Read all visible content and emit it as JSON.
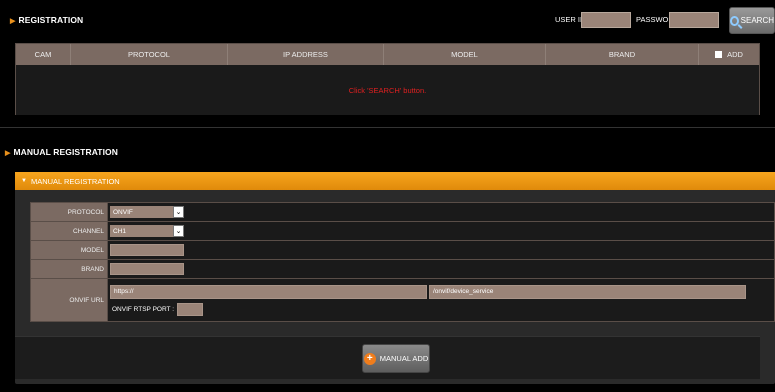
{
  "registration": {
    "title": "REGISTRATION",
    "user_id_label": "USER ID :",
    "user_id_value": "",
    "password_label": "PASSWORD :",
    "password_value": "",
    "search_label": "SEARCH",
    "columns": [
      "CAM",
      "PROTOCOL",
      "IP ADDRESS",
      "MODEL",
      "BRAND",
      "ADD"
    ],
    "message": "Click 'SEARCH' button."
  },
  "manual_registration": {
    "section_title": "MANUAL REGISTRATION",
    "panel_title": "MANUAL REGISTRATION",
    "protocol_label": "PROTOCOL",
    "protocol_value": "ONVIF",
    "channel_label": "CHANNEL",
    "channel_value": "CH1",
    "model_label": "MODEL",
    "model_value": "",
    "brand_label": "BRAND",
    "brand_value": "",
    "onvif_url_label": "ONVIF URL",
    "url_prefix": "https://",
    "url_suffix": "/onvif/device_service",
    "rtsp_port_label": "ONVIF RTSP PORT :",
    "rtsp_port_value": "",
    "manual_add_label": "MANUAL ADD"
  },
  "icons": {
    "section_arrow": "right-triangle",
    "panel_arrow": "down-triangle",
    "search": "magnifier",
    "add": "plus-circle",
    "dropdown": "chevron-down"
  },
  "colors": {
    "accent": "#f39c12",
    "header_cell": "#7b6a62",
    "input": "#9a8478",
    "message": "#e02020"
  }
}
